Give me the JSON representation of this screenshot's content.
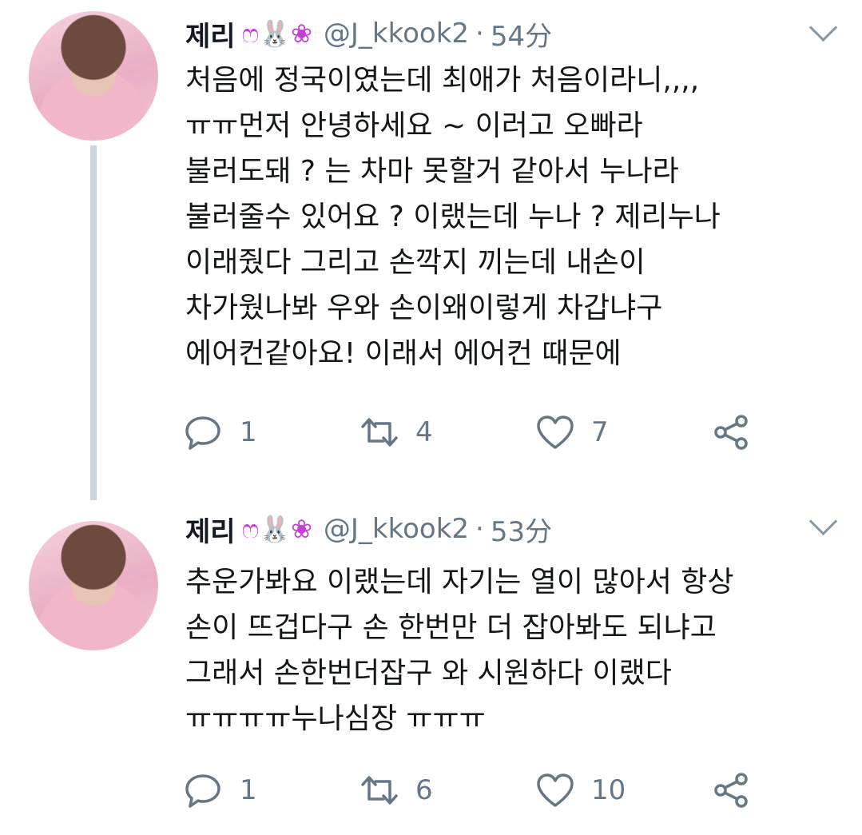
{
  "tweets": [
    {
      "name": "제리",
      "name_emoji": "ෆ🐰❀",
      "handle": "@J_kkook2",
      "separator": "·",
      "time": "54分",
      "lines": [
        "처음에 정국이였는데 최애가 처음이라니,,,,",
        "ㅠㅠ먼저 안녕하세요 ~ 이러고 오빠라",
        "불러도돼 ? 는 차마 못할거 같아서 누나라",
        "불러줄수 있어요 ? 이랬는데 누나 ? 제리누나",
        "이래줬다 그리고 손깍지 끼는데  내손이",
        "차가웠나봐 우와 손이왜이렇게 차갑냐구",
        "에어컨같아요!  이래서 에어컨 때문에"
      ],
      "replies": "1",
      "retweets": "4",
      "likes": "7"
    },
    {
      "name": "제리",
      "name_emoji": "ෆ🐰❀",
      "handle": "@J_kkook2",
      "separator": "·",
      "time": "53分",
      "lines": [
        "추운가봐요 이랬는데 자기는 열이 많아서 항상",
        "손이 뜨겁다구 손 한번만 더 잡아봐도 되냐고",
        "그래서 손한번더잡구 와 시원하다 이랬다",
        "ㅠㅠㅠㅠ누나심장 ㅠㅠㅠ"
      ],
      "replies": "1",
      "retweets": "6",
      "likes": "10"
    }
  ],
  "icons": {
    "reply": "reply-icon",
    "retweet": "retweet-icon",
    "like": "heart-icon",
    "share": "share-icon",
    "menu": "chevron-down-icon"
  },
  "colors": {
    "text": "#14171a",
    "secondary": "#657786",
    "thread_line": "#ccd6dd",
    "emoji_accent": "#c43fd6"
  }
}
